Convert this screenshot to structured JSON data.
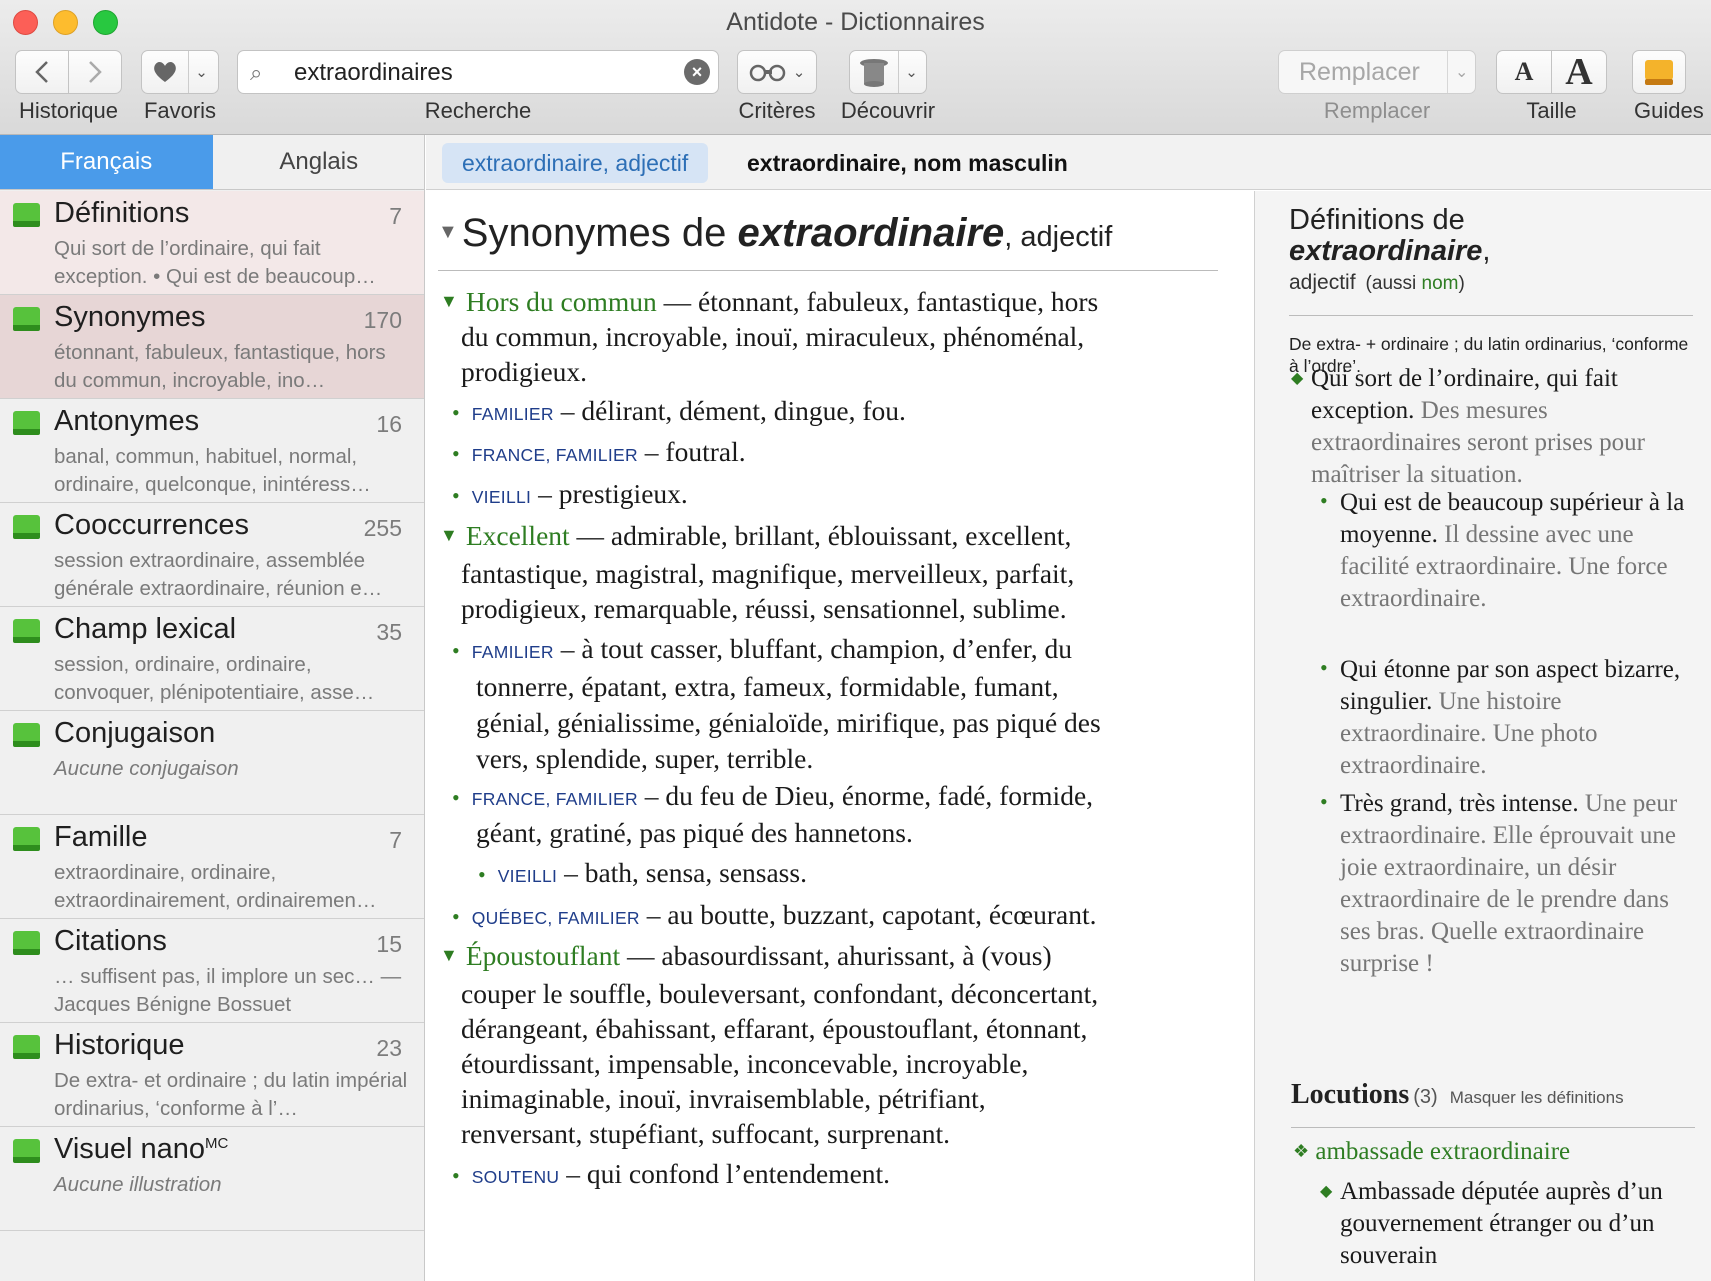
{
  "window": {
    "title": "Antidote - Dictionnaires"
  },
  "toolbar": {
    "historique": "Historique",
    "favoris": "Favoris",
    "search_value": "extraordinaires",
    "recherche": "Recherche",
    "criteres": "Critères",
    "decouvrir": "Découvrir",
    "remplacer_button": "Remplacer",
    "remplacer_label": "Remplacer",
    "taille": "Taille",
    "guides": "Guides"
  },
  "lang_tabs": [
    "Français",
    "Anglais"
  ],
  "sense_tabs": [
    "extraordinaire, adjectif",
    "extraordinaire, nom masculin"
  ],
  "sidebar": {
    "items": [
      {
        "name": "Définitions",
        "count": "7",
        "desc": "Qui sort de l’ordinaire, qui fait exception. • Qui est de beaucoup…"
      },
      {
        "name": "Synonymes",
        "count": "170",
        "desc": "étonnant, fabuleux, fantastique, hors du commun, incroyable, ino…"
      },
      {
        "name": "Antonymes",
        "count": "16",
        "desc": "banal, commun, habituel, normal, ordinaire, quelconque, inintéress…"
      },
      {
        "name": "Cooccurrences",
        "count": "255",
        "desc": "session extraordinaire, assemblée générale extraordinaire, réunion e…"
      },
      {
        "name": "Champ lexical",
        "count": "35",
        "desc": "session, ordinaire, ordinaire, convoquer, plénipotentiaire, asse…"
      },
      {
        "name": "Conjugaison",
        "count": "",
        "desc": "Aucune conjugaison"
      },
      {
        "name": "Famille",
        "count": "7",
        "desc": "extraordinaire, ordinaire, extraordinairement, ordinairemen…"
      },
      {
        "name": "Citations",
        "count": "15",
        "desc": "… suffisent pas, il implore un sec… — Jacques Bénigne Bossuet"
      },
      {
        "name": "Historique",
        "count": "23",
        "desc": "De extra- et ordinaire ; du latin impérial ordinarius, ‘conforme à l’…"
      },
      {
        "name": "Visuel nano",
        "sup": "MC",
        "count": "",
        "desc": "Aucune illustration"
      }
    ]
  },
  "main": {
    "title_prefix": "Synonymes de ",
    "title_word": "extraordinaire",
    "title_pos": ", adjectif",
    "groups": [
      {
        "head": "Hors du commun",
        "line1": "— étonnant, fabuleux, fantastique, hors",
        "rest": [
          "du commun, incroyable, inouï, miraculeux, phénoménal,",
          "prodigieux."
        ],
        "subs": [
          {
            "reg": "FAMILIER",
            "text": "– délirant, dément, dingue, fou."
          },
          {
            "reg": "FRANCE, FAMILIER",
            "text": "– foutral."
          },
          {
            "reg": "VIEILLI",
            "text": "– prestigieux."
          }
        ]
      },
      {
        "head": "Excellent",
        "line1": "— admirable, brillant, éblouissant, excellent,",
        "rest": [
          "fantastique, magistral, magnifique, merveilleux, parfait,",
          "prodigieux, remarquable, réussi, sensationnel, sublime."
        ],
        "subs": [
          {
            "reg": "FAMILIER",
            "text": "– à tout casser, bluffant, champion, d’enfer, du",
            "more": [
              "tonnerre, épatant, extra, fameux, formidable, fumant,",
              "génial, génialissime, génialoïde, mirifique, pas piqué des",
              "vers, splendide, super, terrible."
            ]
          },
          {
            "reg": "FRANCE, FAMILIER",
            "text": "– du feu de Dieu, énorme, fadé, formide,",
            "more": [
              "géant, gratiné, pas piqué des hannetons."
            ]
          },
          {
            "reg": "VIEILLI",
            "text": "– bath, sensa, sensass."
          },
          {
            "reg": "QUÉBEC, FAMILIER",
            "text": "– au boutte, buzzant, capotant, écœurant."
          }
        ]
      },
      {
        "head": "Époustouflant",
        "line1": "— abasourdissant, ahurissant, à (vous)",
        "rest": [
          "couper le souffle, bouleversant, confondant, déconcertant,",
          "dérangeant, ébahissant, effarant, époustouflant, étonnant,",
          "étourdissant, impensable, inconcevable, incroyable,",
          "inimaginable, inouï, invraisemblable, pétrifiant,",
          "renversant, stupéfiant, suffocant, surprenant."
        ],
        "subs": [
          {
            "reg": "SOUTENU",
            "text": "– qui confond l’entendement."
          }
        ]
      }
    ]
  },
  "right": {
    "title_line1": "Définitions de",
    "title_word": "extraordinaire",
    "pos": "adjectif",
    "aussi_prefix": "(aussi ",
    "aussi_link": "nom",
    "aussi_suffix": ")",
    "etym": "De extra- + ordinaire ; du latin ordinarius, ‘conforme à l’ordre’.",
    "defs": [
      {
        "def": "Qui sort de l’ordinaire, qui fait exception.",
        "ex": "Des mesures extraordinaires seront prises pour maîtriser la situation."
      },
      {
        "def": "Qui est de beaucoup supérieur à la moyenne.",
        "ex": "Il dessine avec une facilité extraordinaire. Une force extraordinaire."
      },
      {
        "def": "Qui étonne par son aspect bizarre, singulier.",
        "ex": "Une histoire extraordinaire. Une photo extraordinaire."
      },
      {
        "def": "Très grand, très intense.",
        "ex": "Une peur extraordinaire. Elle éprouvait une joie extraordinaire, un désir extraordinaire de le prendre dans ses bras. Quelle extraordinaire surprise !"
      }
    ],
    "locutions_title": "Locutions",
    "locutions_count": "(3)",
    "locutions_toggle": "Masquer les définitions",
    "locution1": "ambassade extraordinaire",
    "locution1_def": "Ambassade députée auprès d’un gouvernement étranger ou d’un souverain"
  }
}
